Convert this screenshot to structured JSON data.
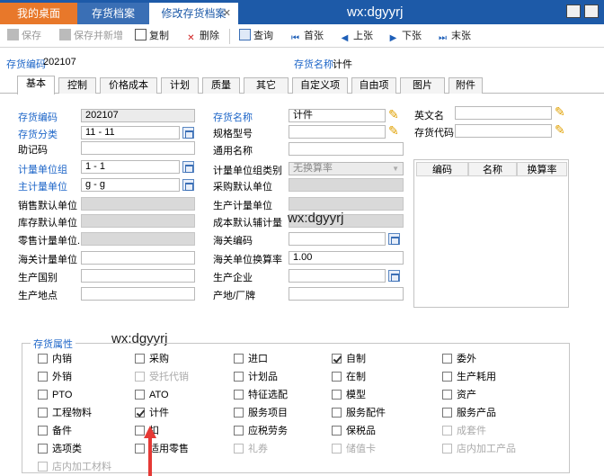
{
  "tabs": [
    {
      "label": "我的桌面"
    },
    {
      "label": "存货档案"
    },
    {
      "label": "修改存货档案"
    }
  ],
  "watermark": "wx:dgyyrj",
  "toolbar": {
    "save": "保存",
    "save_add": "保存并新增",
    "copy": "复制",
    "delete": "删除",
    "query": "查询",
    "first": "首张",
    "prev": "上张",
    "next": "下张",
    "last": "末张"
  },
  "header": {
    "code_label": "存货编码",
    "code_value": "202107",
    "name_label": "存货名称",
    "name_value": "计件"
  },
  "subtabs": [
    "基本",
    "控制",
    "价格成本",
    "计划",
    "质量",
    "其它",
    "自定义项",
    "自由项",
    "图片",
    "附件"
  ],
  "form": {
    "inv_code_label": "存货编码",
    "inv_code": "202107",
    "inv_class_label": "存货分类",
    "inv_class": "11 - 11",
    "mnemonic_label": "助记码",
    "unit_group_label": "计量单位组",
    "unit_group": "1 - 1",
    "main_unit_label": "主计量单位",
    "main_unit": "g - g",
    "sales_unit_label": "销售默认单位",
    "stock_unit_label": "库存默认单位",
    "retail_unit_label": "零售计量单位...",
    "customs_unit_label": "海关计量单位",
    "origin_country_label": "生产国别",
    "origin_place_label": "生产地点",
    "inv_name_label": "存货名称",
    "inv_name": "计件",
    "spec_label": "规格型号",
    "common_name_label": "通用名称",
    "unit_group_type_label": "计量单位组类别",
    "unit_group_type": "无换算率",
    "purchase_unit_label": "采购默认单位",
    "production_unit_label": "生产计量单位",
    "cost_unit_label": "成本默认辅计量",
    "customs_code_label": "海关编码",
    "customs_rate_label": "海关单位换算率",
    "customs_rate": "1.00",
    "manufacturer_label": "生产企业",
    "origin_factory_label": "产地/厂牌",
    "english_name_label": "英文名",
    "proxy_code_label": "存货代码"
  },
  "unit_grid": {
    "headers": [
      "编码",
      "名称",
      "换算率"
    ]
  },
  "attributes": {
    "title": "存货属性",
    "items": [
      {
        "label": "内销",
        "checked": false,
        "disabled": false
      },
      {
        "label": "采购",
        "checked": false,
        "disabled": false
      },
      {
        "label": "进口",
        "checked": false,
        "disabled": false
      },
      {
        "label": "自制",
        "checked": true,
        "disabled": false
      },
      {
        "label": "委外",
        "checked": false,
        "disabled": false
      },
      {
        "label": "外销",
        "checked": false,
        "disabled": false
      },
      {
        "label": "受托代销",
        "checked": false,
        "disabled": true
      },
      {
        "label": "计划品",
        "checked": false,
        "disabled": false
      },
      {
        "label": "在制",
        "checked": false,
        "disabled": false
      },
      {
        "label": "生产耗用",
        "checked": false,
        "disabled": false
      },
      {
        "label": "PTO",
        "checked": false,
        "disabled": false
      },
      {
        "label": "ATO",
        "checked": false,
        "disabled": false
      },
      {
        "label": "特征选配",
        "checked": false,
        "disabled": false
      },
      {
        "label": "模型",
        "checked": false,
        "disabled": false
      },
      {
        "label": "资产",
        "checked": false,
        "disabled": false
      },
      {
        "label": "工程物料",
        "checked": false,
        "disabled": false
      },
      {
        "label": "计件",
        "checked": true,
        "disabled": false
      },
      {
        "label": "服务项目",
        "checked": false,
        "disabled": false
      },
      {
        "label": "服务配件",
        "checked": false,
        "disabled": false
      },
      {
        "label": "服务产品",
        "checked": false,
        "disabled": false
      },
      {
        "label": "备件",
        "checked": false,
        "disabled": false
      },
      {
        "label": "扣",
        "checked": false,
        "disabled": false
      },
      {
        "label": "应税劳务",
        "checked": false,
        "disabled": false
      },
      {
        "label": "保税品",
        "checked": false,
        "disabled": false
      },
      {
        "label": "成套件",
        "checked": false,
        "disabled": true
      },
      {
        "label": "选项类",
        "checked": false,
        "disabled": false
      },
      {
        "label": "适用零售",
        "checked": false,
        "disabled": false
      },
      {
        "label": "礼券",
        "checked": false,
        "disabled": true
      },
      {
        "label": "储值卡",
        "checked": false,
        "disabled": true
      },
      {
        "label": "店内加工产品",
        "checked": false,
        "disabled": true
      },
      {
        "label": "店内加工材料",
        "checked": false,
        "disabled": true
      }
    ]
  }
}
